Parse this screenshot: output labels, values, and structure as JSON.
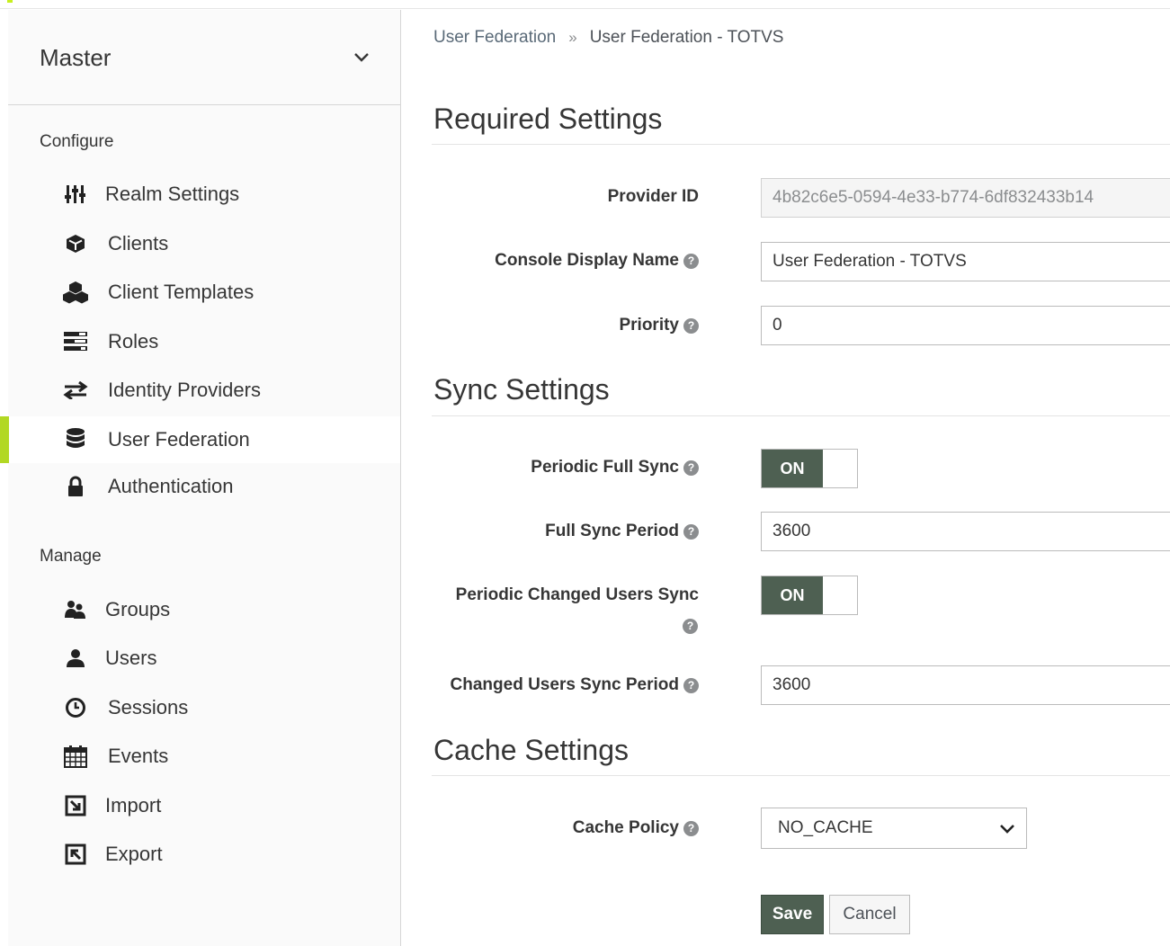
{
  "realm": {
    "name": "Master"
  },
  "sidebar": {
    "configure_label": "Configure",
    "configure_items": [
      {
        "label": "Realm Settings",
        "icon": "sliders-icon"
      },
      {
        "label": "Clients",
        "icon": "cube-icon"
      },
      {
        "label": "Client Templates",
        "icon": "cubes-icon"
      },
      {
        "label": "Roles",
        "icon": "tasks-icon"
      },
      {
        "label": "Identity Providers",
        "icon": "exchange-icon"
      },
      {
        "label": "User Federation",
        "icon": "database-icon",
        "active": true
      },
      {
        "label": "Authentication",
        "icon": "lock-icon"
      }
    ],
    "manage_label": "Manage",
    "manage_items": [
      {
        "label": "Groups",
        "icon": "users-icon"
      },
      {
        "label": "Users",
        "icon": "user-icon"
      },
      {
        "label": "Sessions",
        "icon": "clock-icon"
      },
      {
        "label": "Events",
        "icon": "calendar-icon"
      },
      {
        "label": "Import",
        "icon": "import-icon"
      },
      {
        "label": "Export",
        "icon": "export-icon"
      }
    ]
  },
  "breadcrumb": {
    "parent": "User Federation",
    "separator": "»",
    "current": "User Federation - TOTVS"
  },
  "required": {
    "title": "Required Settings",
    "provider_id_label": "Provider ID",
    "provider_id_value": "4b82c6e5-0594-4e33-b774-6df832433b14",
    "display_name_label": "Console Display Name",
    "display_name_value": "User Federation - TOTVS",
    "priority_label": "Priority",
    "priority_value": "0"
  },
  "sync": {
    "title": "Sync Settings",
    "periodic_full_label": "Periodic Full Sync",
    "periodic_full_state": "ON",
    "full_period_label": "Full Sync Period",
    "full_period_value": "3600",
    "periodic_changed_label": "Periodic Changed Users Sync",
    "periodic_changed_state": "ON",
    "changed_period_label": "Changed Users Sync Period",
    "changed_period_value": "3600"
  },
  "cache": {
    "title": "Cache Settings",
    "policy_label": "Cache Policy",
    "policy_value": "NO_CACHE"
  },
  "actions": {
    "save": "Save",
    "cancel": "Cancel"
  },
  "help_glyph": "?",
  "colors": {
    "accent": "#b2d823",
    "primary": "#4e6052"
  }
}
